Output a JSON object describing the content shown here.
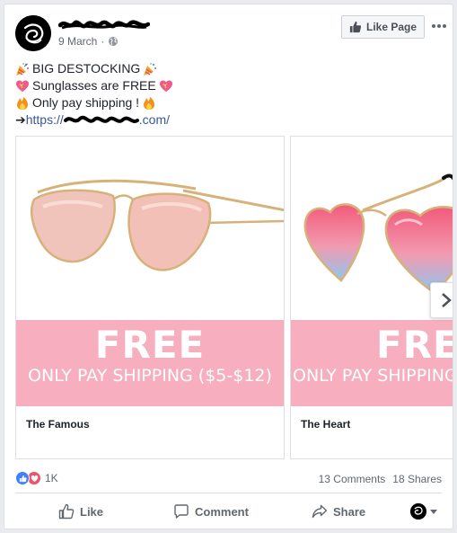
{
  "post": {
    "date": "9 March",
    "meta_separator": "·",
    "like_page_label": "Like Page",
    "text_lines": {
      "line1": "BIG DESTOCKING",
      "line2": "Sunglasses are FREE",
      "line3": "Only pay shipping !",
      "line4_arrow": "➔",
      "line4_prefix": "https://",
      "line4_suffix": ".com/"
    }
  },
  "carousel": {
    "cards": [
      {
        "banner_title": "FREE",
        "banner_subtitle": "ONLY PAY SHIPPING ($5-$12)",
        "caption": "The Famous"
      },
      {
        "banner_title": "FREE",
        "banner_subtitle": "ONLY PAY SHIPPING",
        "caption": "The Heart"
      }
    ]
  },
  "stats": {
    "reaction_count": "1K",
    "comments": "13 Comments",
    "shares": "18 Shares"
  },
  "actions": {
    "like": "Like",
    "comment": "Comment",
    "share": "Share"
  },
  "icons": {
    "party": "party-popper-icon",
    "heart": "sparkling-heart-icon",
    "fire": "fire-icon",
    "globe": "globe-icon",
    "thumb": "thumbs-up-icon",
    "next": "chevron-right-icon"
  },
  "colors": {
    "accent": "#4267b2",
    "link": "#365899",
    "banner_pink": "#f7aebf",
    "like_reaction": "#4080ff",
    "love_reaction": "#f25268",
    "muted_text": "#616770"
  }
}
